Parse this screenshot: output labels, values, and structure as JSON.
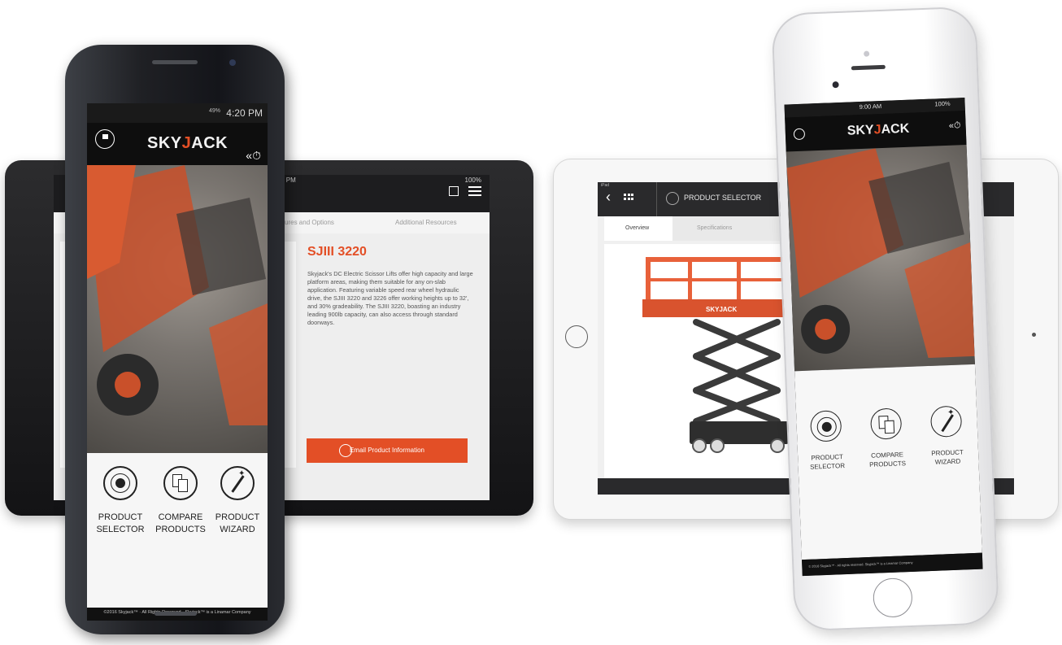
{
  "tablet_left": {
    "status_time": "4:14 PM",
    "status_battery": "100%",
    "tabs": [
      "Features and Options",
      "Additional Resources"
    ],
    "product_title": "SJIII 3220",
    "product_description": "Skyjack's DC Electric Scissor Lifts offer high capacity and large platform areas, making them suitable for any on-slab application. Featuring variable speed rear wheel hydraulic drive, the SJIII 3220 and 3226 offer working heights up to 32', and 30% gradeability. The SJIII 3220, boasting an industry leading 900lb capacity, can also access through standard doorways.",
    "email_button": "Email Product Information"
  },
  "tablet_right": {
    "device_label": "iPad",
    "header_title": "PRODUCT SELECTOR",
    "tabs": [
      "Overview",
      "Specifications"
    ],
    "lift_brand": "SKYJACK"
  },
  "android": {
    "status_time": "4:20 PM",
    "status_battery": "49%",
    "logo_prefix": "SKY",
    "logo_accent": "J",
    "logo_suffix": "ACK",
    "menu": [
      {
        "line1": "PRODUCT",
        "line2": "SELECTOR"
      },
      {
        "line1": "COMPARE",
        "line2": "PRODUCTS"
      },
      {
        "line1": "PRODUCT",
        "line2": "WIZARD"
      }
    ],
    "footer": "©2016 Skyjack™ · All Rights Reserved · Skyjack™ is a Linamar Company"
  },
  "iphone": {
    "status_time": "9:00 AM",
    "status_battery": "100%",
    "logo_prefix": "SKY",
    "logo_accent": "J",
    "logo_suffix": "ACK",
    "menu": [
      {
        "line1": "PRODUCT",
        "line2": "SELECTOR"
      },
      {
        "line1": "COMPARE",
        "line2": "PRODUCTS"
      },
      {
        "line1": "PRODUCT",
        "line2": "WIZARD"
      }
    ],
    "footer": "© 2016 Skyjack™ · All rights reserved. Skyjack™ is a Linamar Company"
  },
  "colors": {
    "accent": "#e34f26",
    "dark": "#111111",
    "menu_bg": "#f6f6f6"
  }
}
